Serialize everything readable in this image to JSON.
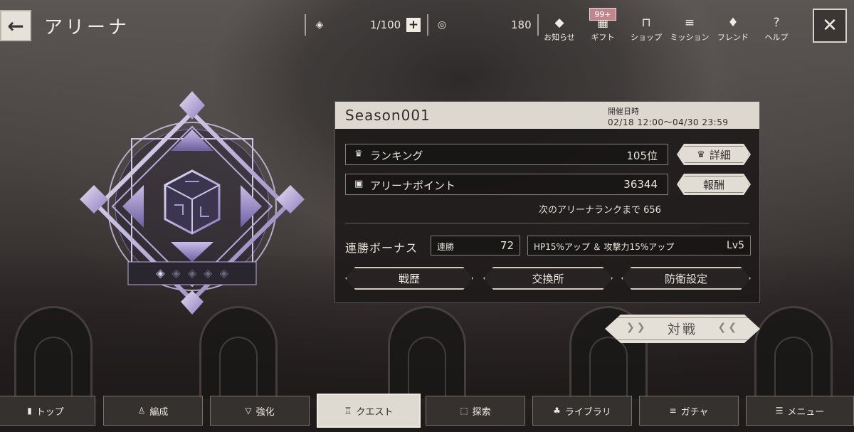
{
  "header": {
    "title": "アリーナ",
    "stamina": "1/100",
    "currency": "180",
    "menu": [
      {
        "label": "お知らせ",
        "icon": "notice-icon"
      },
      {
        "label": "ギフト",
        "icon": "gift-icon",
        "badge": "99+"
      },
      {
        "label": "ショップ",
        "icon": "shop-icon"
      },
      {
        "label": "ミッション",
        "icon": "mission-icon"
      },
      {
        "label": "フレンド",
        "icon": "friend-icon"
      },
      {
        "label": "ヘルプ",
        "icon": "help-icon"
      }
    ]
  },
  "panel": {
    "season": "Season001",
    "period_label": "開催日時",
    "period_value": "02/18 12:00～04/30 23:59",
    "ranking": {
      "label": "ランキング",
      "value": "105位",
      "button": "詳細"
    },
    "points": {
      "label": "アリーナポイント",
      "value": "36344",
      "button": "報酬"
    },
    "next_rank": "次のアリーナランクまで 656",
    "streak": {
      "label": "連勝ボーナス",
      "count_label": "連勝",
      "count_value": "72",
      "bonus": "HP15%アップ ＆ 攻撃力15%アップ",
      "level": "Lv5"
    },
    "buttons": {
      "history": "戦歴",
      "exchange": "交換所",
      "defense": "防衛設定"
    }
  },
  "battle_button": "対戦",
  "emblem": {
    "rank_pips_total": 5,
    "rank_pips_filled": 1
  },
  "bottom_nav": [
    {
      "label": "トップ",
      "icon": "top-icon",
      "active": false
    },
    {
      "label": "編成",
      "icon": "formation-icon",
      "active": false
    },
    {
      "label": "強化",
      "icon": "enhance-icon",
      "active": false
    },
    {
      "label": "クエスト",
      "icon": "quest-icon",
      "active": true
    },
    {
      "label": "探索",
      "icon": "explore-icon",
      "active": false
    },
    {
      "label": "ライブラリ",
      "icon": "library-icon",
      "active": false
    },
    {
      "label": "ガチャ",
      "icon": "gacha-icon",
      "active": false
    },
    {
      "label": "メニュー",
      "icon": "menu-icon",
      "active": false
    }
  ],
  "colors": {
    "panel_header": "#ddd8cf",
    "badge": "#c1868b",
    "emblem_accent": "#a99ad0"
  }
}
